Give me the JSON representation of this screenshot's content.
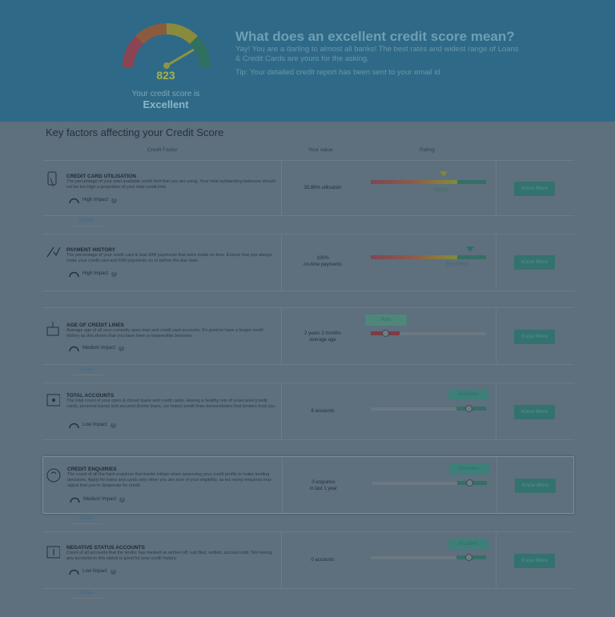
{
  "header": {
    "score": "823",
    "score_caption": "Your credit score is",
    "score_level": "Excellent",
    "headline": "What does an excellent credit score mean?",
    "subline": "Yay! You are a darling to almost all banks! The best rates and widest range of Loans & Credit Cards are yours for the asking.",
    "tip": "Tip: Your detailed credit report has been sent to your email id"
  },
  "section": {
    "title": "Key factors affecting your Credit Score",
    "columns": [
      "Credit Factor",
      "Your value",
      "Rating"
    ]
  },
  "factors": [
    {
      "title": "CREDIT CARD UTILISATION",
      "desc": "The percentage of your total available credit limit that you are using. Your total outstanding balances should not be too high a proportion of your total credit limit.",
      "impact": "High Impact",
      "value": "35.89% utilisation",
      "rating": "Good",
      "button": "Know More",
      "details": "Details"
    },
    {
      "title": "PAYMENT HISTORY",
      "desc": "The percentage of your credit card & loan EMI payments that were made on time. Ensure that you always make your credit card and EMI payments on or before the due date.",
      "impact": "High Impact",
      "value_line1": "100%",
      "value_line2": "on-time payments",
      "rating": "Excellent",
      "button": "Know More"
    },
    {
      "title": "AGE OF CREDIT LINES",
      "desc": "Average age of all your currently open loan and credit card accounts. It's good to have a longer credit history as this shows that you have been a responsible borrower.",
      "impact": "Medium Impact",
      "value_line1": "2 years 2 months",
      "value_line2": "average age",
      "rating": "Poor",
      "button": "Know More",
      "details": "Details"
    },
    {
      "title": "TOTAL ACCOUNTS",
      "desc": "The total count of your open & closed loans and credit cards. Having a healthy mix of unsecured (credit cards, personal loans) and secured (home loans, car loans) credit lines demonstrates that lenders trust you.",
      "impact": "Low Impact",
      "value": "8 accounts",
      "rating": "Excellent",
      "button": "Know More"
    },
    {
      "title": "CREDIT ENQUIRIES",
      "desc": "The count of all the hard enquiries that banks initiate when assessing your credit profile to make lending decisions. Apply for loans and cards only when you are sure of your eligibility, as too many enquiries may signal that you're desperate for credit.",
      "impact": "Medium Impact",
      "value_line1": "0 enquiries",
      "value_line2": "in last 1 year",
      "rating": "Excellent",
      "button": "Know More",
      "details": "Details"
    },
    {
      "title": "NEGATIVE STATUS ACCOUNTS",
      "desc": "Count of all accounts that the lender has marked as written off, suit filed, settled, account sold. Not having any accounts in this status is good for your credit history.",
      "impact": "Low Impact",
      "value": "0 accounts",
      "rating": "Excellent",
      "button": "Know More",
      "details": "Details"
    }
  ]
}
